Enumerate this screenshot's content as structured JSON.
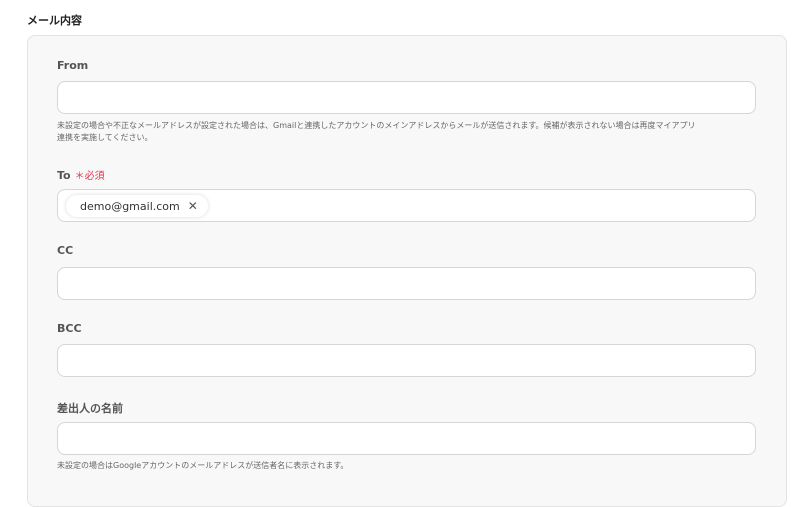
{
  "section_title": "メール内容",
  "fields": {
    "from": {
      "label": "From",
      "value": "",
      "hint_line1": "未設定の場合や不正なメールアドレスが設定された場合は、Gmailと連携したアカウントのメインアドレスからメールが送信されます。候補が表示されない場合は再度マイアプリ",
      "hint_line2": "連携を実施してください。"
    },
    "to": {
      "label": "To",
      "required_mark": "＊必須",
      "chip": "demo@gmail.com",
      "chip_close": "✕"
    },
    "cc": {
      "label": "CC",
      "value": ""
    },
    "bcc": {
      "label": "BCC",
      "value": ""
    },
    "sender_name": {
      "label": "差出人の名前",
      "value": "",
      "hint": "未設定の場合はGoogleアカウントのメールアドレスが送信者名に表示されます。"
    }
  }
}
